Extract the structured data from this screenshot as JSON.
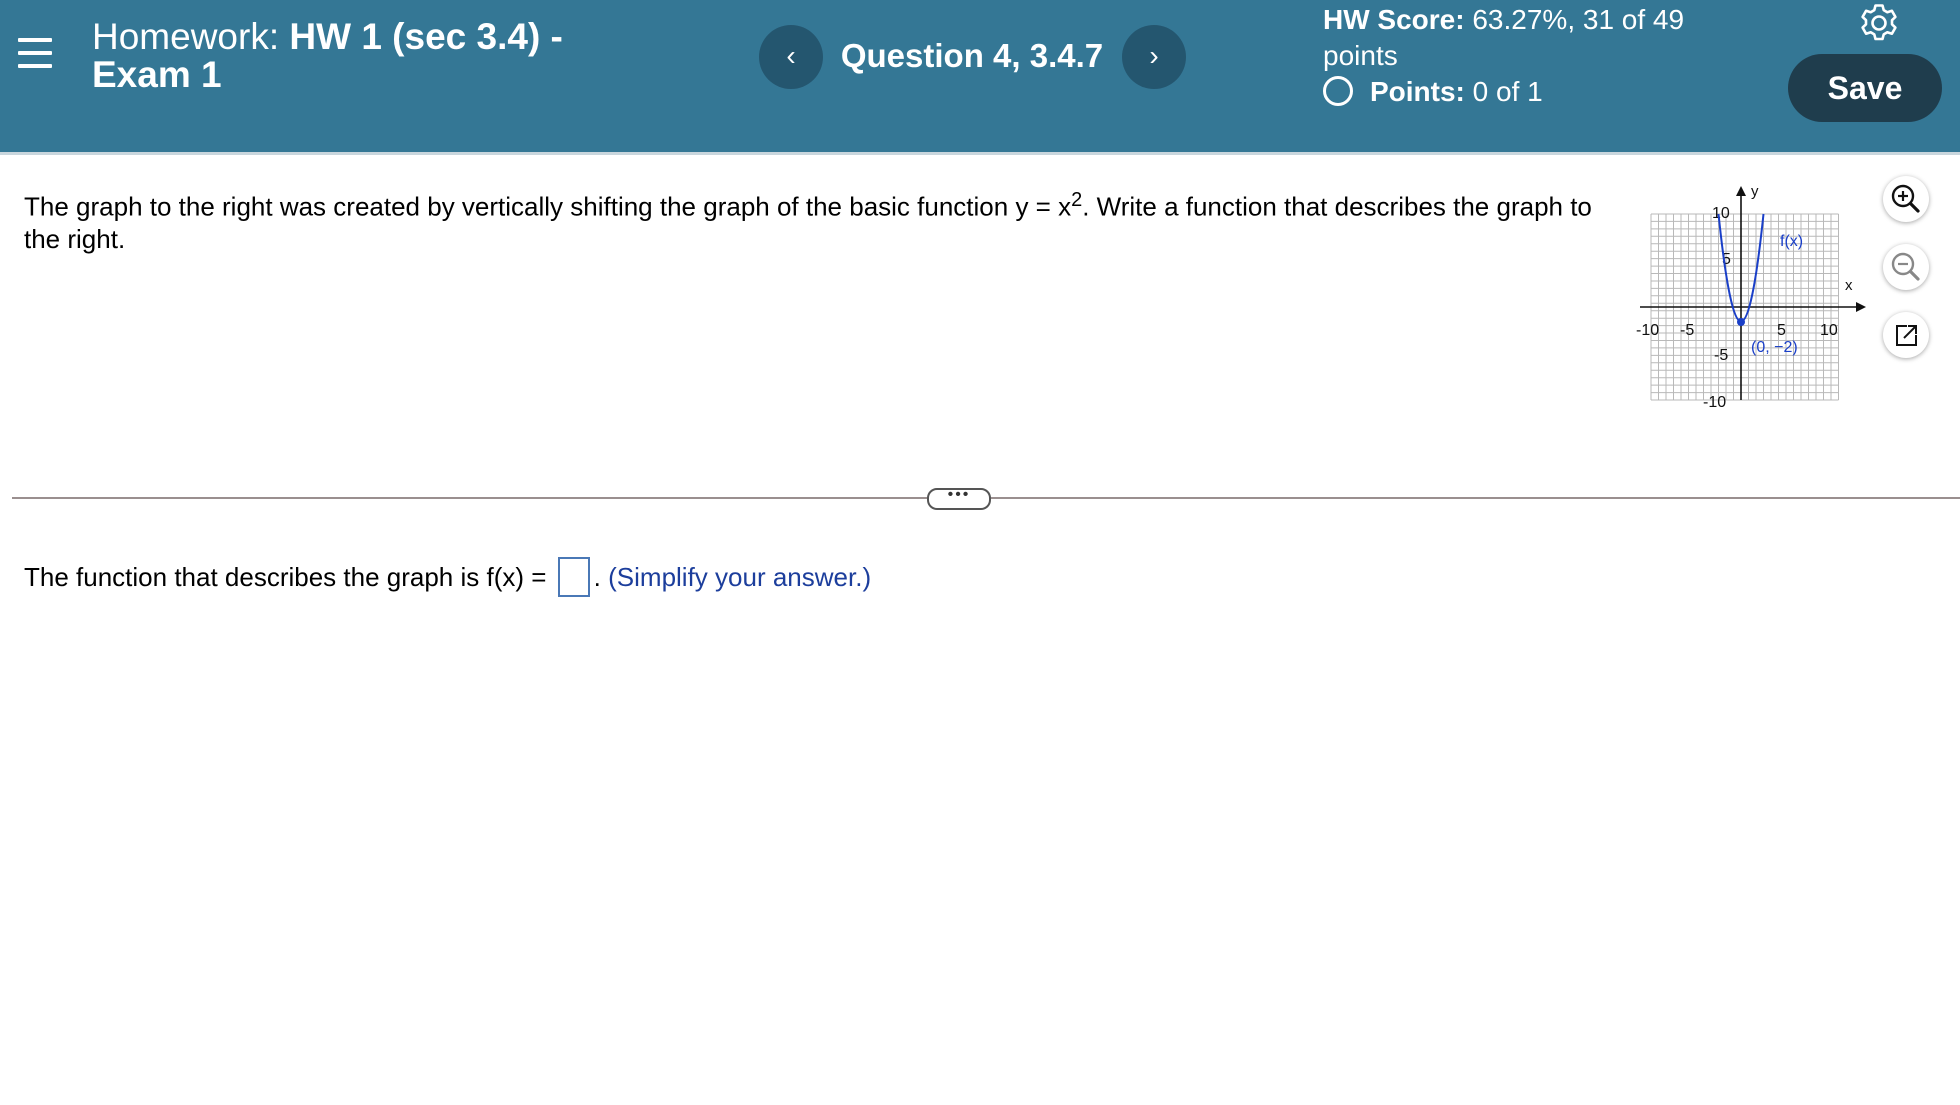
{
  "header": {
    "title_prefix": "Homework: ",
    "title_name": "HW 1 (sec 3.4) - Exam 1",
    "prev_label": "‹",
    "next_label": "›",
    "question_label": "Question 4, 3.4.7",
    "score_label": "HW Score:",
    "score_value": " 63.27%, 31 of 49 points",
    "points_label": "Points:",
    "points_value": " 0 of 1",
    "save_label": "Save",
    "colors": {
      "bar": "#347795",
      "nav_button": "#24566f",
      "save_button": "#1f3d4d"
    }
  },
  "question": {
    "prompt_part1": "The graph to the right was created by vertically shifting the graph of the basic function y = x",
    "prompt_exponent": "2",
    "prompt_part2": ". Write a function that describes the graph to the right.",
    "answer_prefix": "The function that describes the graph is f(x) = ",
    "answer_suffix": ".",
    "hint": "(Simplify your answer.)"
  },
  "graph": {
    "y_axis_label": "y",
    "x_axis_label": "x",
    "function_label": "f(x)",
    "vertex_label": "(0, −2)",
    "ticks": {
      "y_top": "10",
      "y_mid": "5",
      "y_neg_mid": "-5",
      "y_bottom": "-10",
      "x_left": "-10",
      "x_left_mid": "-5",
      "x_right_mid": "5",
      "x_right": "10"
    },
    "curve_color": "#1a3fc8"
  },
  "toolbar": {
    "zoom_in": "zoom-in",
    "zoom_out": "zoom-out",
    "popout": "open-in-new-window"
  },
  "divider": {
    "more_label": "•••"
  }
}
